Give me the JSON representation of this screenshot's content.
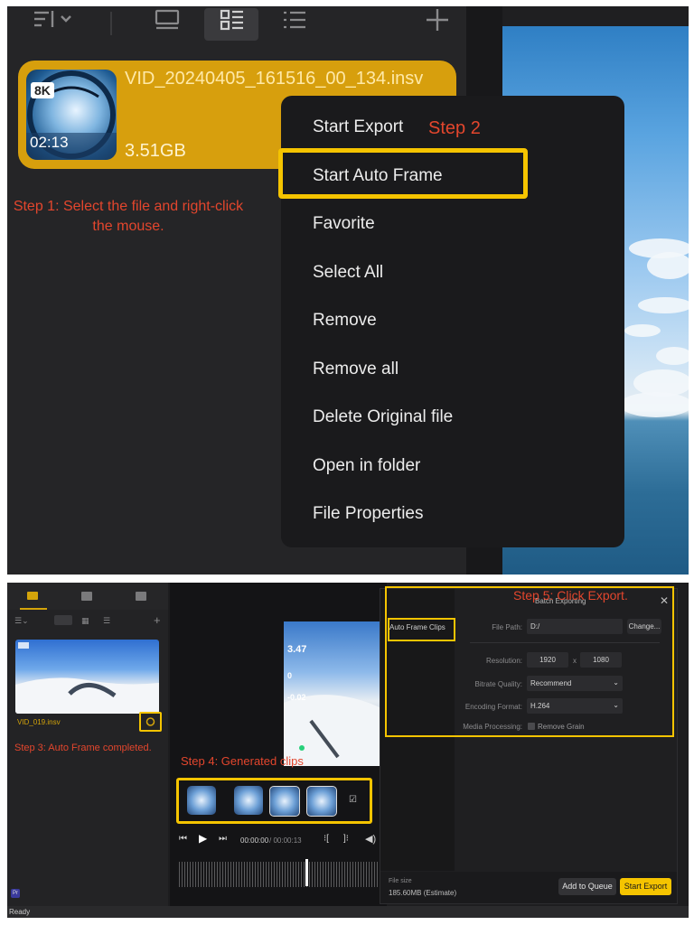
{
  "top": {
    "file": {
      "badge": "8K",
      "duration": "02:13",
      "name": "VID_20240405_161516_00_134.insv",
      "size": "3.51GB"
    },
    "step1": "Step 1: Select the file and right-click the mouse.",
    "step2": "Step 2",
    "menu": {
      "start_export": "Start Export",
      "start_auto_frame": "Start Auto Frame",
      "favorite": "Favorite",
      "select_all": "Select All",
      "remove": "Remove",
      "remove_all": "Remove all",
      "delete_original": "Delete Original file",
      "open_folder": "Open in folder",
      "file_properties": "File Properties"
    },
    "toolbar_icons": [
      "sort-icon",
      "single-view-icon",
      "grid-view-icon",
      "list-view-icon",
      "add-icon"
    ]
  },
  "bottom": {
    "clip_name": "VID_019.insv",
    "step3": "Step 3: Auto Frame completed.",
    "step4": "Step 4: Generated clips",
    "step5": "Step 5: Click Export.",
    "phone_overlay": {
      "speed": "3.47",
      "distance": "0",
      "elevation": "-0.02"
    },
    "timecode_current": "00:00:00",
    "timecode_total": "/ 00:00:13",
    "dialog": {
      "title": "Batch Exporting",
      "close": "✕",
      "tab": "Auto Frame Clips",
      "file_path_label": "File Path:",
      "file_path_value": "D:/",
      "change_button": "Change...",
      "resolution_label": "Resolution:",
      "res_w": "1920",
      "res_x": "x",
      "res_h": "1080",
      "bitrate_label": "Bitrate Quality:",
      "bitrate_value": "Recommend",
      "encoding_label": "Encoding Format:",
      "encoding_value": "H.264",
      "media_label": "Media Processing:",
      "remove_grain": "Remove Grain",
      "file_size_label": "File size",
      "file_size_value": "185.60MB (Estimate)",
      "add_queue": "Add to Queue",
      "start_export": "Start Export"
    },
    "status": "Ready"
  },
  "colors": {
    "accent": "#f5c400",
    "file_card": "#d79f0d",
    "step_text": "#e3462d"
  }
}
